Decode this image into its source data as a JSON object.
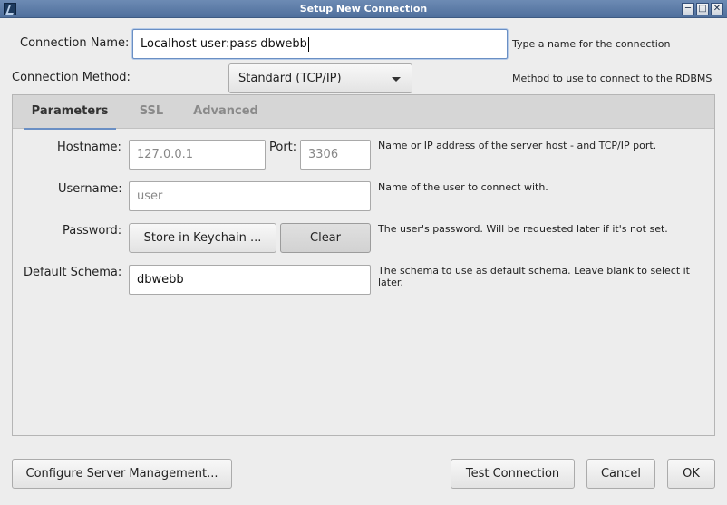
{
  "window": {
    "title": "Setup New Connection"
  },
  "connection_name": {
    "label": "Connection Name:",
    "value": "Localhost user:pass dbwebb",
    "hint": "Type a name for the connection"
  },
  "connection_method": {
    "label": "Connection Method:",
    "value": "Standard (TCP/IP)",
    "hint": "Method to use to connect to the RDBMS"
  },
  "tabs": [
    {
      "label": "Parameters",
      "active": true
    },
    {
      "label": "SSL",
      "active": false
    },
    {
      "label": "Advanced",
      "active": false
    }
  ],
  "parameters": {
    "hostname": {
      "label": "Hostname:",
      "placeholder": "127.0.0.1"
    },
    "port": {
      "label": "Port:",
      "placeholder": "3306"
    },
    "host_hint": "Name or IP address of the server host - and TCP/IP port.",
    "username": {
      "label": "Username:",
      "placeholder": "user",
      "hint": "Name of the user to connect with."
    },
    "password": {
      "label": "Password:",
      "store_button": "Store in Keychain ...",
      "clear_button": "Clear",
      "hint": "The user's password. Will be requested later if it's not set."
    },
    "default_schema": {
      "label": "Default Schema:",
      "value": "dbwebb",
      "hint": "The schema to use as default schema. Leave blank to select it later."
    }
  },
  "footer": {
    "configure_button": "Configure Server Management...",
    "test_button": "Test Connection",
    "cancel_button": "Cancel",
    "ok_button": "OK"
  },
  "colors": {
    "titlebar": "#5a7aa6",
    "focus": "#6a8fc4",
    "background": "#ededed"
  }
}
